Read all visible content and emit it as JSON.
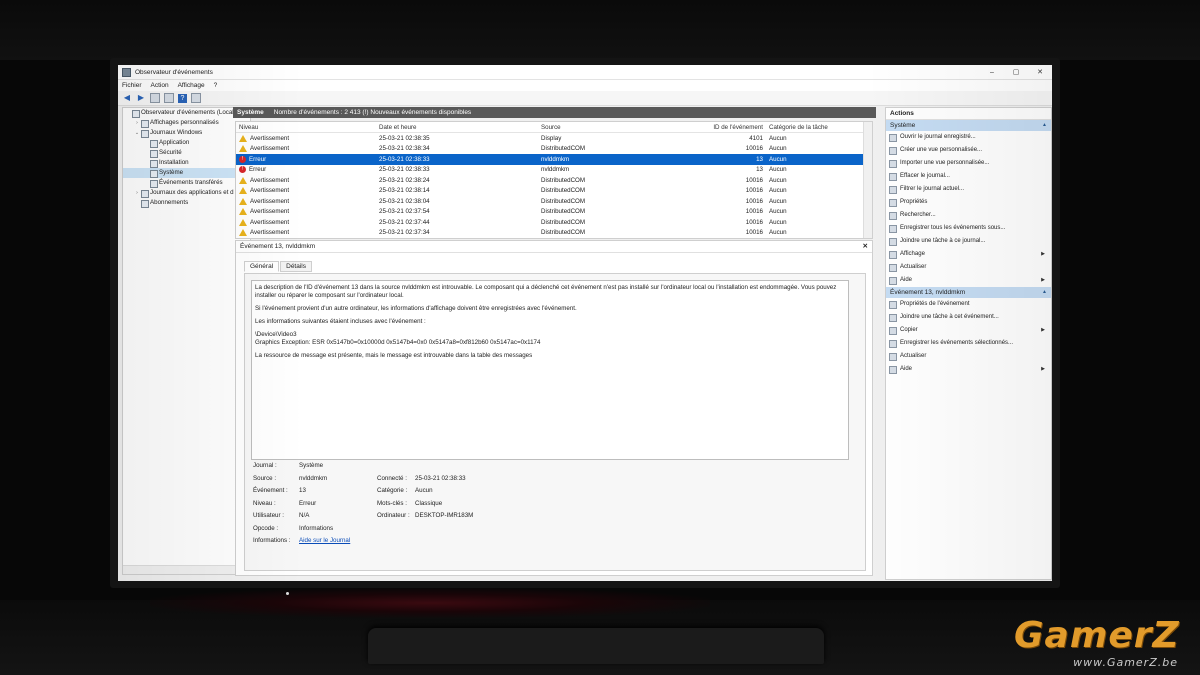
{
  "window": {
    "title": "Observateur d'événements",
    "min": "–",
    "max": "▢",
    "close": "✕"
  },
  "menu": [
    "Fichier",
    "Action",
    "Affichage",
    "?"
  ],
  "tree": {
    "items": [
      {
        "label": "Observateur d'événements (Local)",
        "indent": 0,
        "caret": ""
      },
      {
        "label": "Affichages personnalisés",
        "indent": 1,
        "caret": ">"
      },
      {
        "label": "Journaux Windows",
        "indent": 1,
        "caret": "v"
      },
      {
        "label": "Application",
        "indent": 2,
        "caret": ""
      },
      {
        "label": "Sécurité",
        "indent": 2,
        "caret": ""
      },
      {
        "label": "Installation",
        "indent": 2,
        "caret": ""
      },
      {
        "label": "Système",
        "indent": 2,
        "caret": "",
        "selected": true
      },
      {
        "label": "Événements transférés",
        "indent": 2,
        "caret": ""
      },
      {
        "label": "Journaux des applications et d",
        "indent": 1,
        "caret": ">"
      },
      {
        "label": "Abonnements",
        "indent": 1,
        "caret": ""
      }
    ]
  },
  "header": {
    "title": "Système",
    "count": "Nombre d'événements : 2 413 (!) Nouveaux événements disponibles"
  },
  "grid": {
    "columns": [
      "Niveau",
      "Date et heure",
      "Source",
      "ID de l'événement",
      "Catégorie de la tâche"
    ],
    "rows": [
      {
        "level": "Avertissement",
        "type": "warn",
        "date": "25-03-21 02:38:35",
        "source": "Display",
        "id": "4101",
        "cat": "Aucun"
      },
      {
        "level": "Avertissement",
        "type": "warn",
        "date": "25-03-21 02:38:34",
        "source": "DistributedCOM",
        "id": "10016",
        "cat": "Aucun"
      },
      {
        "level": "Erreur",
        "type": "err",
        "date": "25-03-21 02:38:33",
        "source": "nvlddmkm",
        "id": "13",
        "cat": "Aucun",
        "selected": true
      },
      {
        "level": "Erreur",
        "type": "err",
        "date": "25-03-21 02:38:33",
        "source": "nvlddmkm",
        "id": "13",
        "cat": "Aucun"
      },
      {
        "level": "Avertissement",
        "type": "warn",
        "date": "25-03-21 02:38:24",
        "source": "DistributedCOM",
        "id": "10016",
        "cat": "Aucun"
      },
      {
        "level": "Avertissement",
        "type": "warn",
        "date": "25-03-21 02:38:14",
        "source": "DistributedCOM",
        "id": "10016",
        "cat": "Aucun"
      },
      {
        "level": "Avertissement",
        "type": "warn",
        "date": "25-03-21 02:38:04",
        "source": "DistributedCOM",
        "id": "10016",
        "cat": "Aucun"
      },
      {
        "level": "Avertissement",
        "type": "warn",
        "date": "25-03-21 02:37:54",
        "source": "DistributedCOM",
        "id": "10016",
        "cat": "Aucun"
      },
      {
        "level": "Avertissement",
        "type": "warn",
        "date": "25-03-21 02:37:44",
        "source": "DistributedCOM",
        "id": "10016",
        "cat": "Aucun"
      },
      {
        "level": "Avertissement",
        "type": "warn",
        "date": "25-03-21 02:37:34",
        "source": "DistributedCOM",
        "id": "10016",
        "cat": "Aucun"
      }
    ]
  },
  "detail": {
    "title": "Événement 13, nvlddmkm",
    "close": "✕",
    "tabs": [
      "Général",
      "Détails"
    ],
    "description": [
      "La description de l'ID d'événement 13 dans la source nvlddmkm est introuvable. Le composant qui a déclenché cet événement n'est pas installé sur l'ordinateur local ou l'installation est endommagée. Vous pouvez installer ou réparer le composant sur l'ordinateur local.",
      "Si l'événement provient d'un autre ordinateur, les informations d'affichage doivent être enregistrées avec l'événement.",
      "Les informations suivantes étaient incluses avec l'événement :",
      "\\Device\\Video3\nGraphics Exception: ESR 0x5147b0=0x10000d 0x5147b4=0x0 0x5147a8=0xf812b60 0x5147ac=0x1174",
      "La ressource de message est présente, mais le message est introuvable dans la table des messages"
    ],
    "fields": {
      "journal_label": "Journal :",
      "journal": "Système",
      "source_label": "Source :",
      "source": "nvlddmkm",
      "event_label": "Événement :",
      "event": "13",
      "level_label": "Niveau :",
      "level": "Erreur",
      "user_label": "Utilisateur :",
      "user": "N/A",
      "opcode_label": "Opcode :",
      "opcode": "Informations",
      "info_label": "Informations :",
      "info": "Aide sur le Journal",
      "connected_label": "Connecté :",
      "connected": "25-03-21 02:38:33",
      "category_label": "Catégorie :",
      "category": "Aucun",
      "keywords_label": "Mots-clés :",
      "keywords": "Classique",
      "computer_label": "Ordinateur :",
      "computer": "DESKTOP-IMR183M"
    }
  },
  "actions": {
    "title": "Actions",
    "section1": "Système",
    "items1": [
      {
        "label": "Ouvrir le journal enregistré...",
        "arrow": ""
      },
      {
        "label": "Créer une vue personnalisée...",
        "arrow": ""
      },
      {
        "label": "Importer une vue personnalisée...",
        "arrow": ""
      },
      {
        "label": "Effacer le journal...",
        "arrow": ""
      },
      {
        "label": "Filtrer le journal actuel...",
        "arrow": ""
      },
      {
        "label": "Propriétés",
        "arrow": ""
      },
      {
        "label": "Rechercher...",
        "arrow": ""
      },
      {
        "label": "Enregistrer tous les événements sous...",
        "arrow": ""
      },
      {
        "label": "Joindre une tâche à ce journal...",
        "arrow": ""
      },
      {
        "label": "Affichage",
        "arrow": "▶"
      },
      {
        "label": "Actualiser",
        "arrow": ""
      },
      {
        "label": "Aide",
        "arrow": "▶"
      }
    ],
    "section2": "Événement 13, nvlddmkm",
    "items2": [
      {
        "label": "Propriétés de l'événement",
        "arrow": ""
      },
      {
        "label": "Joindre une tâche à cet événement...",
        "arrow": ""
      },
      {
        "label": "Copier",
        "arrow": "▶"
      },
      {
        "label": "Enregistrer les événements sélectionnés...",
        "arrow": ""
      },
      {
        "label": "Actualiser",
        "arrow": ""
      },
      {
        "label": "Aide",
        "arrow": "▶"
      }
    ]
  },
  "watermark": {
    "logo": "GamerZ",
    "url": "www.GamerZ.be"
  },
  "colors": {
    "selection": "#0a64c9",
    "header": "#595959",
    "warning": "#e8b21c",
    "error": "#d7262b",
    "section": "#c5dcf3",
    "watermark": "#e29b2b"
  }
}
